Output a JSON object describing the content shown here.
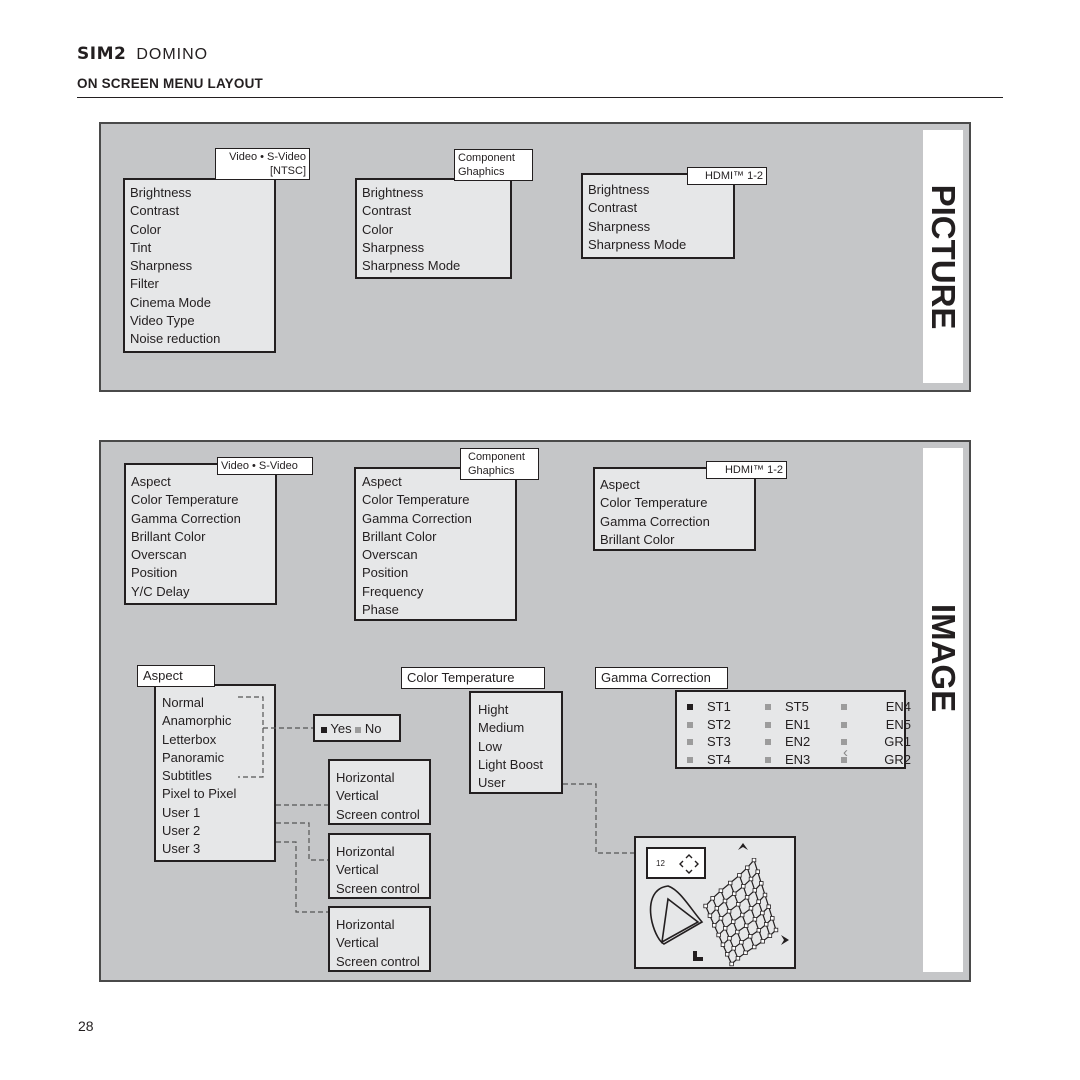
{
  "header": {
    "brand": "SIM2",
    "product": "DOMINO",
    "title": "ON SCREEN MENU LAYOUT"
  },
  "picture_section": {
    "label": "PICTURE",
    "menus": [
      {
        "source": "Video • S-Video [NTSC]",
        "source_line1": "Video • S-Video",
        "source_line2": "[NTSC]",
        "items": [
          "Brightness",
          "Contrast",
          "Color",
          "Tint",
          "Sharpness",
          "Filter",
          "Cinema Mode",
          "Video Type",
          "Noise reduction"
        ]
      },
      {
        "source_line1": "Component",
        "source_line2": "Ghaphics",
        "items": [
          "Brightness",
          "Contrast",
          "Color",
          "Sharpness",
          "Sharpness Mode"
        ]
      },
      {
        "source_line1": "HDMI™ 1-2",
        "items": [
          "Brightness",
          "Contrast",
          "Sharpness",
          "Sharpness Mode"
        ]
      }
    ]
  },
  "image_section": {
    "label": "IMAGE",
    "menus": [
      {
        "source_line1": "Video • S-Video",
        "items": [
          "Aspect",
          "Color Temperature",
          "Gamma Correction",
          "Brillant Color",
          "Overscan",
          "Position",
          "Y/C  Delay"
        ]
      },
      {
        "source_line1": "Component",
        "source_line2": "Ghaphics",
        "items": [
          "Aspect",
          "Color Temperature",
          "Gamma Correction",
          "Brillant Color",
          "Overscan",
          "Position",
          "Frequency",
          "Phase"
        ]
      },
      {
        "source_line1": "HDMI™ 1-2",
        "items": [
          "Aspect",
          "Color Temperature",
          "Gamma Correction",
          "Brillant Color"
        ]
      }
    ],
    "aspect": {
      "title": "Aspect",
      "items": [
        "Normal",
        "Anamorphic",
        "Letterbox",
        "Panoramic",
        "Subtitles",
        "Pixel to Pixel",
        "User 1",
        "User 2",
        "User 3"
      ],
      "subtitle_option": {
        "yes": "Yes",
        "no": "No",
        "selected": "Yes"
      },
      "user_submenus": [
        {
          "items": [
            "Horizontal",
            "Vertical",
            "Screen control"
          ]
        },
        {
          "items": [
            "Horizontal",
            "Vertical",
            "Screen control"
          ]
        },
        {
          "items": [
            "Horizontal",
            "Vertical",
            "Screen control"
          ]
        }
      ]
    },
    "color_temperature": {
      "title": "Color Temperature",
      "items": [
        "Hight",
        "Medium",
        "Low",
        "Light Boost",
        "User"
      ],
      "user_panel": {
        "value": "12"
      }
    },
    "gamma_correction": {
      "title": "Gamma Correction",
      "options": [
        "ST1",
        "ST5",
        "EN4",
        "ST2",
        "EN1",
        "EN5",
        "ST3",
        "EN2",
        "GR1",
        "ST4",
        "EN3",
        "GR2"
      ],
      "selected": "ST1"
    }
  },
  "footer": {
    "page_number": "28"
  }
}
